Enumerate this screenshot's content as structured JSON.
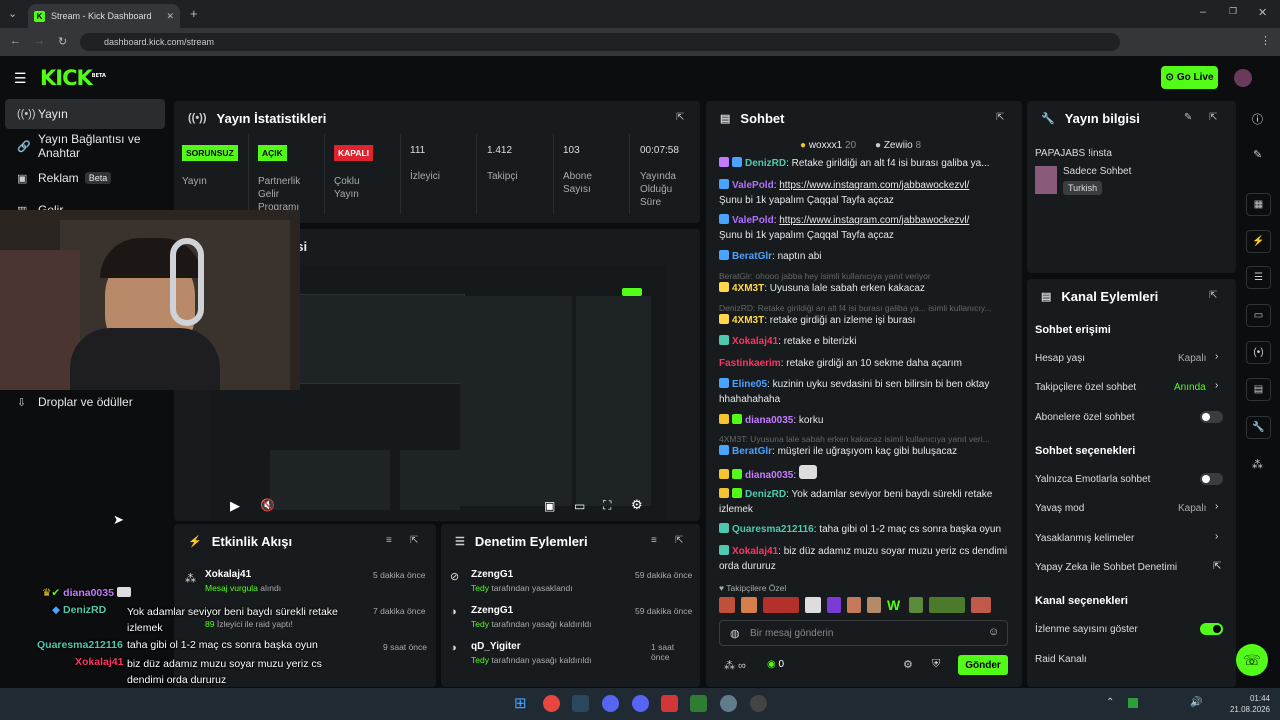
{
  "browser": {
    "tab_title": "Stream - Kick Dashboard",
    "url": "dashboard.kick.com/stream"
  },
  "header": {
    "logo": "KICK",
    "logo_beta": "BETA",
    "go_live": "Go Live"
  },
  "sidebar": {
    "items": [
      {
        "label": "Yayın",
        "icon": "broadcast-icon"
      },
      {
        "label": "Yayın Bağlantısı ve Anahtar",
        "icon": "link-icon"
      },
      {
        "label": "Reklam",
        "icon": "ad-icon",
        "badge": "Beta"
      },
      {
        "label": "Gelir",
        "icon": "revenue-icon"
      },
      {
        "label": "Droplar ve ödüller",
        "icon": "drops-icon"
      }
    ]
  },
  "stats": {
    "title": "Yayın İstatistikleri",
    "cards": [
      {
        "badge": "SORUNSUZ",
        "label": "Yayın",
        "color": "#53fc18"
      },
      {
        "badge": "AÇIK",
        "label": "Partnerlik Gelir Programı",
        "color": "#53fc18"
      },
      {
        "badge": "KAPALI",
        "label": "Çoklu Yayın",
        "color": "#e0242f"
      },
      {
        "value": "111",
        "label": "İzleyici"
      },
      {
        "value": "1.412",
        "label": "Takipçi"
      },
      {
        "value": "103",
        "label": "Abone Sayısı"
      },
      {
        "value": "00:07:58",
        "label": "Yayında Olduğu Süre"
      }
    ]
  },
  "preview": {
    "title_partial": "esi"
  },
  "chat": {
    "title": "Sohbet",
    "top_gifters": [
      {
        "name": "woxxx1",
        "count": "20"
      },
      {
        "name": "Zewiio",
        "count": "8"
      }
    ],
    "messages": [
      {
        "user": "DenizRD",
        "color": "#4ec9b0",
        "text": ": Retake girildiği an alt f4 isi burası galiba ya..."
      },
      {
        "user": "ValePold",
        "color": "#b070ff",
        "text": ": ",
        "link": "https://www.instagram.com/jabbawockezvl/",
        "cont": "Şunu bi 1k yapalım Çaqqal Tayfa açcaz"
      },
      {
        "user": "ValePold",
        "color": "#b070ff",
        "text": ": ",
        "link": "https://www.instagram.com/jabbawockezvl/",
        "cont": "Şunu bi 1k yapalım Çaqqal Tayfa açcaz"
      },
      {
        "user": "BeratGlr",
        "color": "#4aa3ff",
        "text": ": naptın abi"
      },
      {
        "reply": "BeratGlr: ohooo jabba hey isimli kullanıcıya yanıt veriyor"
      },
      {
        "user": "4XM3T",
        "color": "#ffd84a",
        "text": ": Uyusuna lale sabah erken kakacaz"
      },
      {
        "reply": "DenizRD: Retake girildiği an alt f4 isi burası galiba ya... isimli kullanıcıy..."
      },
      {
        "user": "4XM3T",
        "color": "#ffd84a",
        "text": ": retake girdiği an izleme işi burası"
      },
      {
        "user": "Xokalaj41",
        "color": "#ff3366",
        "text": ": retake e biterizki"
      },
      {
        "user": "Fastinkaerim",
        "color": "#ff3366",
        "text": ": retake girdiği an 10 sekme daha açarım"
      },
      {
        "user": "Eline05",
        "color": "#4aa3ff",
        "text": ": kuzinin uyku sevdasini bi sen bilirsin bi ben oktay hhahahahaha"
      },
      {
        "user": "diana0035",
        "color": "#c37bff",
        "text": ": korku"
      },
      {
        "reply": "4XM3T: Uyusuna lale sabah erken kakacaz isimli kullanıcıya yanıt veri..."
      },
      {
        "user": "BeratGlr",
        "color": "#4aa3ff",
        "text": ": müşteri ile uğraşıyom kaç gibi buluşacaz"
      },
      {
        "user": "diana0035",
        "color": "#c37bff",
        "text": ":"
      },
      {
        "user": "DenizRD",
        "color": "#4ec9b0",
        "text": ": Yok adamlar seviyor beni baydı sürekli retake izlemek"
      },
      {
        "user": "Quaresma212116",
        "color": "#4ec9b0",
        "text": ": taha gibi ol 1-2 maç cs sonra başka oyun"
      },
      {
        "user": "Xokalaj41",
        "color": "#ff3366",
        "text": ": biz düz adamız muzu soyar muzu yeriz cs dendimi orda dururuz"
      }
    ],
    "followers_only": "Takipçilere Özel",
    "input_placeholder": "Bir mesaj gönderin",
    "counter": "0",
    "send": "Gönder"
  },
  "stream_info": {
    "title": "Yayın bilgisi",
    "stream_title": "PAPAJABS !insta",
    "category": "Sadece Sohbet",
    "tag": "Turkish"
  },
  "channel_actions": {
    "title": "Kanal Eylemleri",
    "chat_access": "Sohbet erişimi",
    "account_age": "Hesap yaşı",
    "account_age_val": "Kapalı",
    "followers_chat": "Takipçilere özel sohbet",
    "followers_chat_val": "Anında",
    "subs_chat": "Abonelere özel sohbet",
    "chat_options": "Sohbet seçenekleri",
    "emote_only": "Yalnızca Emotlarla sohbet",
    "slow_mode": "Yavaş mod",
    "slow_mode_val": "Kapalı",
    "banned_words": "Yasaklanmış kelimeler",
    "ai_moderation": "Yapay Zeka ile Sohbet Denetimi",
    "channel_options": "Kanal seçenekleri",
    "show_viewers": "İzlenme sayısını göster",
    "raid": "Raid Kanalı"
  },
  "activity": {
    "title": "Etkinlik Akışı",
    "items": [
      {
        "name": "Xokalaj41",
        "sub": "Mesaj vurgula",
        "sub2": " alındı",
        "time": "5 dakika önce"
      },
      {
        "name": "",
        "sub": "89",
        "sub2": " İzleyici ile raid yaptı!",
        "time": "7 dakika önce"
      },
      {
        "name": "",
        "sub": "",
        "sub2": "",
        "time": "9 saat önce"
      }
    ]
  },
  "moderation": {
    "title": "Denetim Eylemleri",
    "items": [
      {
        "name": "ZzengG1",
        "actor": "Tedy",
        "action": " tarafından yasaklandı",
        "time": "59 dakika önce"
      },
      {
        "name": "ZzengG1",
        "actor": "Tedy",
        "action": " tarafından yasağı kaldırıldı",
        "time": "59 dakika önce"
      },
      {
        "name": "qD_Yigiter",
        "actor": "Tedy",
        "action": " tarafından yasağı kaldırıldı",
        "time": "1 saat önce"
      }
    ]
  },
  "overlay_chat": [
    {
      "user": "diana0035",
      "color": "#c37bff",
      "text": ""
    },
    {
      "user": "DenizRD",
      "color": "#4ec9b0",
      "text": "Yok adamlar seviyor beni baydı sürekli retake izlemek"
    },
    {
      "user": "Quaresma212116",
      "color": "#4ec9b0",
      "text": "taha gibi ol 1-2 maç cs sonra başka oyun"
    },
    {
      "user": "Xokalaj41",
      "color": "#ff3366",
      "text": "biz düz adamız muzu soyar muzu yeriz cs dendimi orda dururuz"
    }
  ],
  "taskbar": {
    "time": "01:44",
    "date": "21.08.2026"
  }
}
